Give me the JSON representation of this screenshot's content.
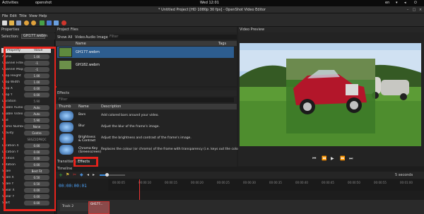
{
  "topbar": {
    "activities": "Activities",
    "app": "openshot",
    "clock": "Wed 12:01",
    "lang": "en"
  },
  "window": {
    "title": "* Untitled Project [HD 1080p 30 fps] - OpenShot Video Editor"
  },
  "menu": [
    "File",
    "Edit",
    "Title",
    "View",
    "Help"
  ],
  "properties": {
    "dock_title": "Properties",
    "selection_label": "Selection:",
    "selected_clip": "GH177.webm",
    "header": {
      "property": "Property",
      "value": "Value"
    },
    "rows": [
      {
        "name": "Alpha",
        "value": "1.00"
      },
      {
        "name": "Channel Filter",
        "value": "-1"
      },
      {
        "name": "Channel Mapping",
        "value": "-1"
      },
      {
        "name": "Crop Height",
        "value": "1.00"
      },
      {
        "name": "Crop Width",
        "value": "1.00"
      },
      {
        "name": "Crop X",
        "value": "0.00"
      },
      {
        "name": "Crop Y",
        "value": "0.00"
      },
      {
        "name": "Duration",
        "value": "5.90",
        "plain": true
      },
      {
        "name": "Enable Audio",
        "value": "Auto"
      },
      {
        "name": "Enable Video",
        "value": "Auto"
      },
      {
        "name": "End",
        "value": "5.90"
      },
      {
        "name": "Frame Number",
        "value": "None"
      },
      {
        "name": "Gravity",
        "value": "Centre"
      },
      {
        "name": "ID",
        "value": "SBSZ2DP8QC",
        "plain": true
      },
      {
        "name": "Location X",
        "value": "0.00"
      },
      {
        "name": "Location Y",
        "value": "0.00"
      },
      {
        "name": "Position",
        "value": "0.00"
      },
      {
        "name": "Rotation",
        "value": "0.00"
      },
      {
        "name": "Scale",
        "value": "Best Fit"
      },
      {
        "name": "Scale X",
        "value": "0.50"
      },
      {
        "name": "Scale Y",
        "value": "0.50"
      },
      {
        "name": "Shear X",
        "value": "0.00"
      },
      {
        "name": "Shear Y",
        "value": "0.00"
      },
      {
        "name": "Start",
        "value": "0.00"
      }
    ]
  },
  "project_files": {
    "dock_title": "Project Files",
    "tabs": [
      "Show All",
      "Video",
      "Audio",
      "Image"
    ],
    "filter_placeholder": "Filter",
    "columns": {
      "name": "Name",
      "tags": "Tags"
    },
    "files": [
      {
        "name": "GH177.webm"
      },
      {
        "name": "GH182.webm"
      }
    ]
  },
  "effects": {
    "dock_title": "Effects",
    "filter_placeholder": "Filter",
    "columns": {
      "thumb": "Thumb",
      "name": "Name",
      "description": "Description"
    },
    "items": [
      {
        "name": "Bars",
        "description": "Add colored bars around your video."
      },
      {
        "name": "Blur",
        "description": "Adjust the blur of the frame's image."
      },
      {
        "name": "Brightness & Contrast",
        "description": "Adjust the brightness and contrast of the frame's image."
      },
      {
        "name": "Chroma Key (Greenscreen)",
        "description": "Replaces the colour (or chroma) of the frame with transparency (i.e. keys out the color)."
      }
    ],
    "bottom_tabs": [
      "Transitions",
      "Effects"
    ]
  },
  "preview": {
    "dock_title": "Video Preview"
  },
  "timeline": {
    "dock_title": "Timeline",
    "timecode": "00:00:00:01",
    "zoom": "5 seconds",
    "ticks": [
      "00:00:05",
      "00:00:10",
      "00:00:15",
      "00:00:20",
      "00:00:25",
      "00:00:30",
      "00:00:35",
      "00:00:40",
      "00:00:45",
      "00:00:50",
      "00:00:55",
      "00:01:00"
    ],
    "track_label": "Track 2",
    "clip_label": "GH177..."
  }
}
